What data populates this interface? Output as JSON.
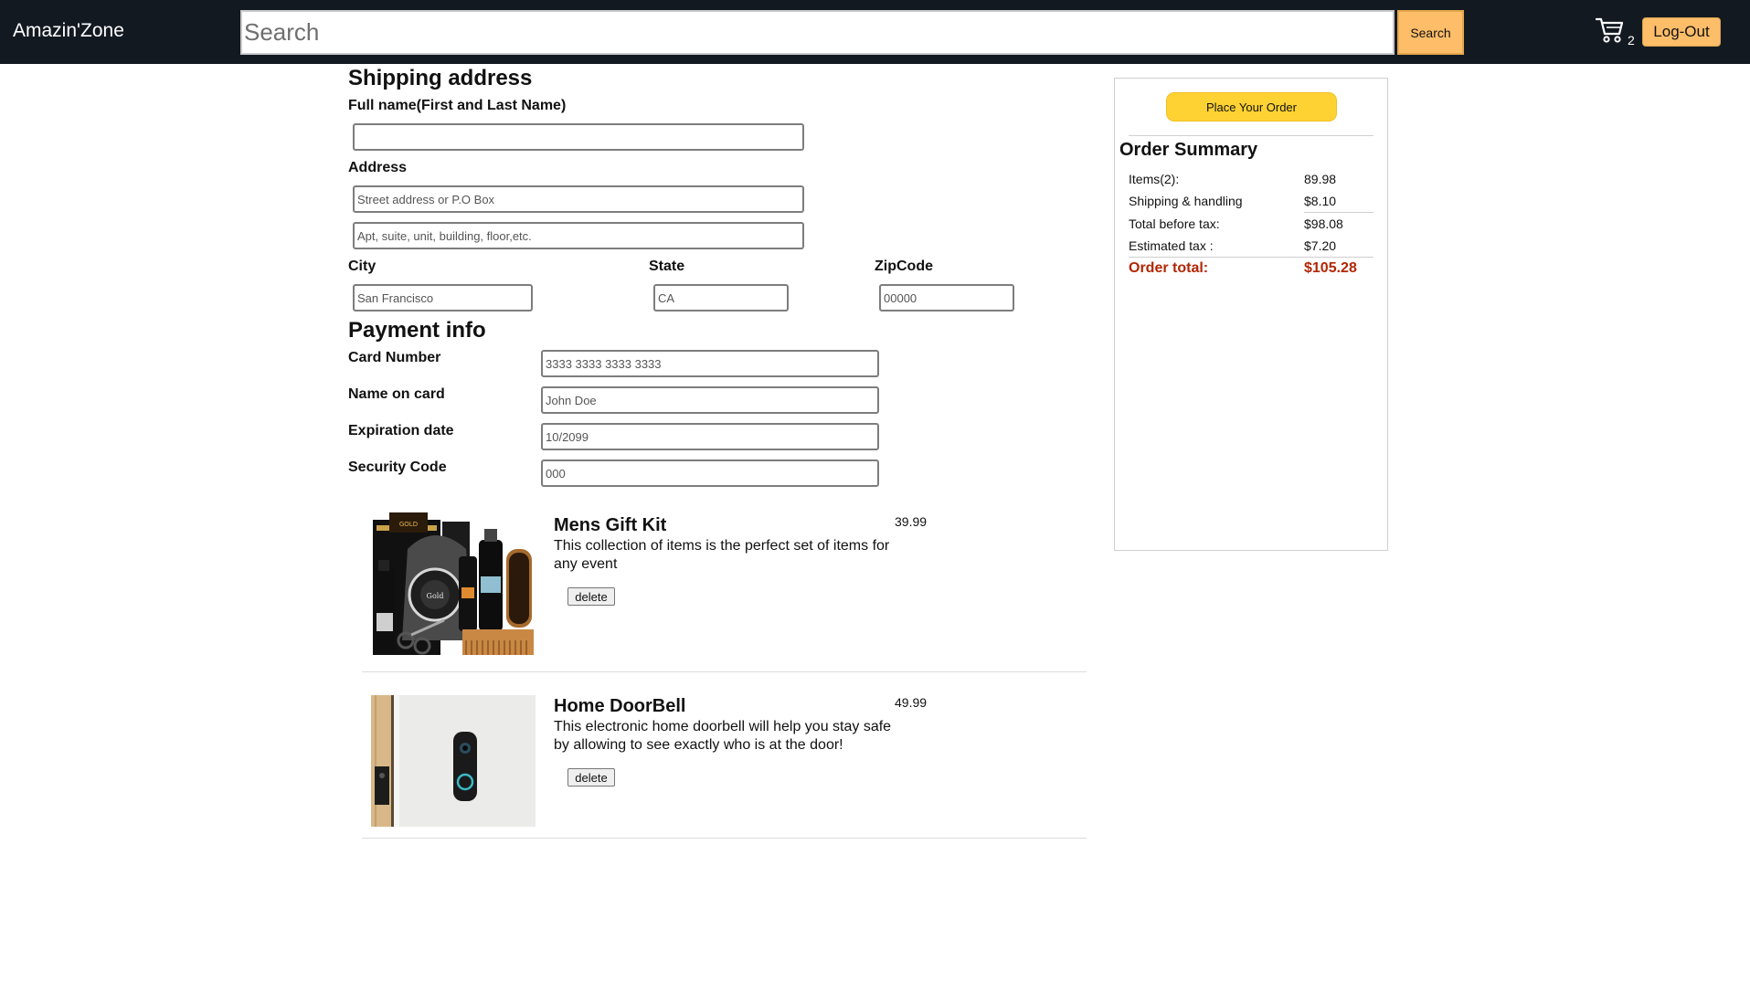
{
  "header": {
    "brand": "Amazin'Zone",
    "search_placeholder": "Search",
    "search_button": "Search",
    "cart_count": "2",
    "logout_button": "Log-Out"
  },
  "shipping": {
    "title": "Shipping address",
    "fullname_label": "Full name(First and Last Name)",
    "fullname_value": "",
    "address_label": "Address",
    "address1_placeholder": "Street address or P.O Box",
    "address2_placeholder": "Apt, suite, unit, building, floor,etc.",
    "city_label": "City",
    "city_placeholder": "San Francisco",
    "state_label": "State",
    "state_placeholder": "CA",
    "zip_label": "ZipCode",
    "zip_placeholder": "00000"
  },
  "payment": {
    "title": "Payment info",
    "card_number_label": "Card Number",
    "card_number_placeholder": "3333 3333 3333 3333",
    "name_label": "Name on card",
    "name_placeholder": "John Doe",
    "expiration_label": "Expiration date",
    "expiration_placeholder": "10/2099",
    "security_label": "Security Code",
    "security_placeholder": "000"
  },
  "cart_items": [
    {
      "title": "Mens Gift Kit",
      "price": "39.99",
      "description": "This collection of items is the perfect set of items for any event",
      "delete_label": "delete",
      "image_icon": "mens-gift-kit-image"
    },
    {
      "title": "Home DoorBell",
      "price": "49.99",
      "description": "This electronic home doorbell will help you stay safe by allowing to see exactly who is at the door!",
      "delete_label": "delete",
      "image_icon": "doorbell-image"
    }
  ],
  "summary": {
    "place_order_button": "Place Your Order",
    "title": "Order Summary",
    "rows": [
      {
        "label": "Items(2):",
        "value": "89.98"
      },
      {
        "label": "Shipping & handling",
        "value": "$8.10"
      },
      {
        "label": "Total before tax:",
        "value": "$98.08"
      },
      {
        "label": "Estimated tax :",
        "value": "$7.20"
      },
      {
        "label": "Order total:",
        "value": "$105.28"
      }
    ]
  },
  "colors": {
    "header_bg": "#131921",
    "button_accent": "#febd69",
    "place_order_bg": "#ffd234",
    "order_total": "#b12704"
  }
}
